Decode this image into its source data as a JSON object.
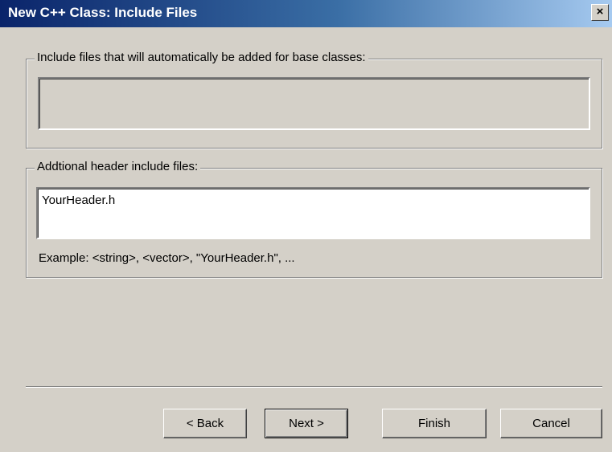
{
  "window": {
    "title": "New C++ Class: Include Files",
    "close_label": "×"
  },
  "base_includes": {
    "label": "Include files that will automatically be added for base classes:",
    "value": ""
  },
  "additional_includes": {
    "label": "Addtional header include files:",
    "value": "YourHeader.h",
    "example": "Example: <string>, <vector>, \"YourHeader.h\", ..."
  },
  "buttons": {
    "back": "< Back",
    "next": "Next >",
    "finish": "Finish",
    "cancel": "Cancel"
  }
}
